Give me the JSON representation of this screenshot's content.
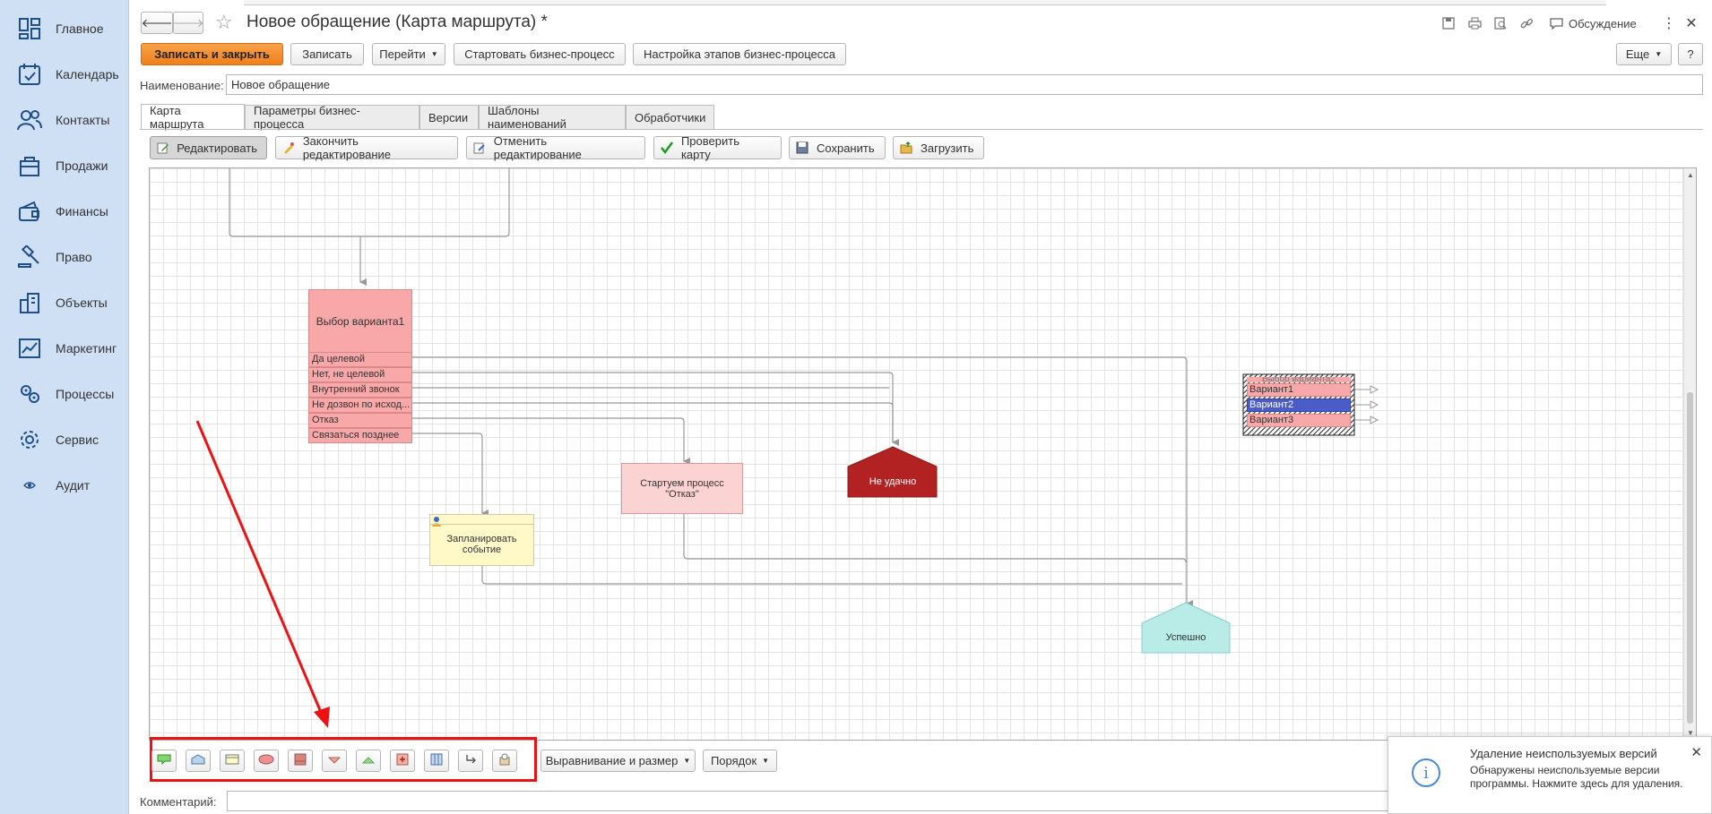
{
  "sidebar": {
    "items": [
      {
        "label": "Главное",
        "icon": "dashboard-icon"
      },
      {
        "label": "Календарь",
        "icon": "calendar-icon"
      },
      {
        "label": "Контакты",
        "icon": "contacts-icon"
      },
      {
        "label": "Продажи",
        "icon": "sales-icon"
      },
      {
        "label": "Финансы",
        "icon": "finance-icon"
      },
      {
        "label": "Право",
        "icon": "law-icon"
      },
      {
        "label": "Объекты",
        "icon": "objects-icon"
      },
      {
        "label": "Маркетинг",
        "icon": "marketing-icon"
      },
      {
        "label": "Процессы",
        "icon": "processes-icon"
      },
      {
        "label": "Сервис",
        "icon": "gear-icon"
      },
      {
        "label": "Аудит",
        "icon": "eye-icon"
      }
    ]
  },
  "header": {
    "title": "Новое обращение (Карта маршрута) *",
    "discussion_label": "Обсуждение"
  },
  "toolbar": {
    "save_close": "Записать и закрыть",
    "save": "Записать",
    "goto": "Перейти",
    "start_bp": "Стартовать бизнес-процесс",
    "setup_bp": "Настройка этапов бизнес-процесса",
    "more": "Еще",
    "help": "?"
  },
  "name_field": {
    "label": "Наименование:",
    "value": "Новое обращение"
  },
  "tabs": [
    "Карта маршрута",
    "Параметры бизнес-процесса",
    "Версии",
    "Шаблоны наименований",
    "Обработчики"
  ],
  "map_toolbar": {
    "edit": "Редактировать",
    "finish_edit": "Закончить редактирование",
    "cancel_edit": "Отменить редактирование",
    "check_map": "Проверить карту",
    "save": "Сохранить",
    "load": "Загрузить"
  },
  "diagram": {
    "choice1": {
      "title": "Выбор варианта1",
      "options": [
        "Да целевой",
        "Нет, не целевой",
        "Внутренний звонок",
        "Не дозвон по исход...",
        "Отказ",
        "Связаться позднее"
      ]
    },
    "start_reject": "Стартуем процесс \"Отказ\"",
    "fail": "Не удачно",
    "plan_event": "Запланировать событие",
    "success": "Успешно",
    "choice2": {
      "title": "Выбор варианта2",
      "options": [
        "Вариант1",
        "Вариант2",
        "Вариант3"
      ]
    }
  },
  "bottom_toolbar": {
    "align": "Выравнивание и размер",
    "order": "Порядок"
  },
  "comment": {
    "label": "Комментарий:",
    "value": ""
  },
  "notification": {
    "title": "Удаление неиспользуемых версий",
    "text": "Обнаружены неиспользуемые версии программы. Нажмите здесь для удаления."
  },
  "colors": {
    "choice_fill": "#f8a8a8",
    "fail_fill": "#b22222",
    "success_fill": "#b9ece6",
    "event_fill": "#fff9c8",
    "primary_button": "#f08a24",
    "annotation_red": "#e11111"
  }
}
